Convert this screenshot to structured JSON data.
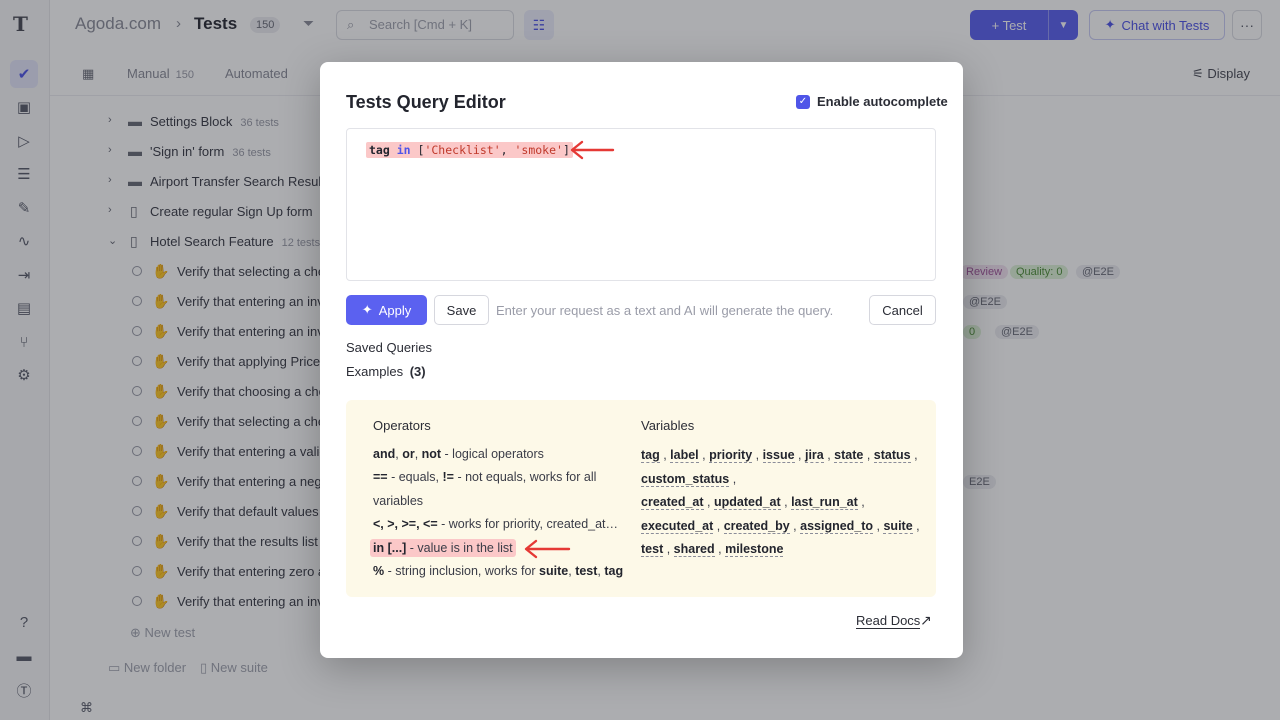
{
  "header": {
    "project": "Agoda.com",
    "separator": "›",
    "title": "Tests",
    "count": "150",
    "search_placeholder": "Search [Cmd + K]",
    "new_test_label": "Test",
    "chat_label": "Chat with Tests",
    "more_label": "···"
  },
  "subnav": {
    "tabs": [
      {
        "label": "Manual",
        "count": "150"
      },
      {
        "label": "Automated",
        "count": ""
      }
    ],
    "display_label": "Display"
  },
  "tree": {
    "suites": [
      {
        "label": "Settings Block",
        "count": "36 tests"
      },
      {
        "label": "'Sign in' form",
        "count": "36 tests"
      },
      {
        "label": "Airport Transfer Search Results",
        "count": ""
      },
      {
        "label": "Create regular Sign Up form",
        "count": "1"
      },
      {
        "label": "Hotel Search Feature",
        "count": "12 tests"
      }
    ],
    "tests": [
      "Verify that selecting a che",
      "Verify that entering an inv",
      "Verify that entering an inv",
      "Verify that applying Price:",
      "Verify that choosing a che",
      "Verify that selecting a che",
      "Verify that entering a valid",
      "Verify that entering a nega",
      "Verify that default values a",
      "Verify that the results list c",
      "Verify that entering zero a",
      "Verify that entering an inv"
    ],
    "tags": [
      "Review",
      "Quality: 0",
      "@E2E",
      "@E2E",
      "0",
      "@E2E",
      "E2E"
    ],
    "new_test": "New test",
    "new_folder": "New folder",
    "new_suite": "New suite"
  },
  "modal": {
    "title": "Tests Query Editor",
    "autocomplete_label": "Enable autocomplete",
    "autocomplete_checked": true,
    "query": {
      "field": "tag",
      "operator": "in",
      "open": "[",
      "v1": "'Checklist'",
      "comma": ", ",
      "v2": "'smoke'",
      "close": "]"
    },
    "apply_label": "Apply",
    "save_label": "Save",
    "ai_placeholder": "Enter your request as a text and AI will generate the query.",
    "cancel_label": "Cancel",
    "saved_queries_label": "Saved Queries",
    "examples_label": "Examples",
    "examples_count": "(3)",
    "help": {
      "operators_heading": "Operators",
      "variables_heading": "Variables",
      "op_logical_b": "and",
      "op_logical_sep1": ", ",
      "op_logical_b2": "or",
      "op_logical_sep2": ", ",
      "op_logical_b3": "not",
      "op_logical_text": " - logical operators",
      "op_eq_b": "==",
      "op_eq_text": " - equals, ",
      "op_neq_b": "!=",
      "op_neq_text": " - not equals, works for all",
      "op_eq_text2": "variables",
      "op_cmp_b": "<, >, >=, <=",
      "op_cmp_text": " - works for priority, created_at…",
      "op_in_b": "in [...]",
      "op_in_text": " - value is in the list",
      "op_pct_b": "%",
      "op_pct_text": " - string inclusion, works for ",
      "op_pct_b2": "suite",
      "op_pct_b3": "test",
      "op_pct_b4": "tag",
      "variables": [
        "tag",
        "label",
        "priority",
        "issue",
        "jira",
        "state",
        "status",
        "custom_status",
        "created_at",
        "updated_at",
        "last_run_at",
        "executed_at",
        "created_by",
        "assigned_to",
        "suite",
        "test",
        "shared",
        "milestone"
      ]
    },
    "read_docs_label": "Read Docs"
  },
  "icons": {
    "accent": "#5b61f0",
    "highlight": "#fbc8c8",
    "help_bg": "#fdf9e8",
    "annotation_arrow": "#e53935"
  }
}
